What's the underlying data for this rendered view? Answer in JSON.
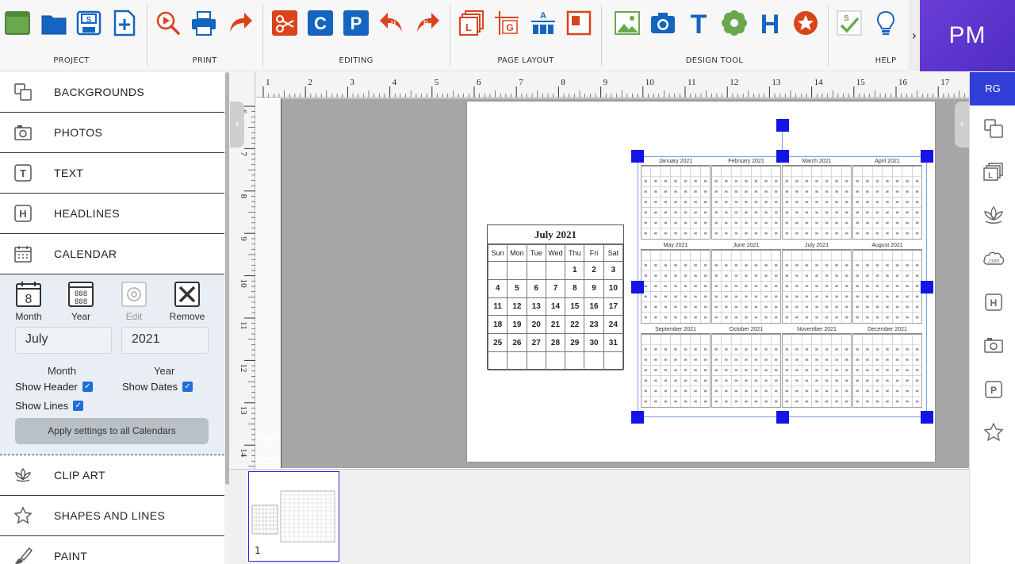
{
  "toolbar": {
    "groups": [
      {
        "label": "PROJECT"
      },
      {
        "label": "PRINT"
      },
      {
        "label": "EDITING"
      },
      {
        "label": "PAGE LAYOUT"
      },
      {
        "label": "DESIGN TOOL"
      },
      {
        "label": "HELP"
      }
    ],
    "more_glyph": "›",
    "brand_text": "PM"
  },
  "left_panel": {
    "items_top": [
      {
        "label": "BACKGROUNDS",
        "icon": "backgrounds-icon"
      },
      {
        "label": "PHOTOS",
        "icon": "camera-icon"
      },
      {
        "label": "TEXT",
        "icon": "text-icon"
      },
      {
        "label": "HEADLINES",
        "icon": "headline-icon"
      },
      {
        "label": "CALENDAR",
        "icon": "calendar-icon"
      }
    ],
    "calendar": {
      "tools": [
        {
          "label": "Month",
          "glyph": "8"
        },
        {
          "label": "Year",
          "glyph": "888"
        },
        {
          "label": "Edit",
          "disabled": true
        },
        {
          "label": "Remove"
        }
      ],
      "month_value": "July",
      "year_value": "2021",
      "month_label": "Month",
      "year_label": "Year",
      "show_header": "Show Header",
      "show_dates": "Show Dates",
      "show_lines": "Show Lines",
      "apply_button": "Apply settings to all Calendars"
    },
    "items_bottom": [
      {
        "label": "CLIP ART",
        "icon": "lotus-icon"
      },
      {
        "label": "SHAPES AND LINES",
        "icon": "star-icon"
      },
      {
        "label": "PAINT",
        "icon": "brush-icon"
      }
    ]
  },
  "canvas": {
    "ruler_top": [
      "1",
      "2",
      "3",
      "4",
      "5",
      "6",
      "7",
      "8",
      "9",
      "10",
      "11",
      "12",
      "13",
      "14",
      "15",
      "16",
      "17"
    ],
    "ruler_left": [
      "6",
      "7",
      "8",
      "9",
      "10",
      "11",
      "12",
      "13",
      "14"
    ],
    "zoom_in": "+",
    "zoom_out": "−",
    "month_calendar": {
      "title": "July 2021",
      "weekdays": [
        "Sun",
        "Mon",
        "Tue",
        "Wed",
        "Thu",
        "Fri",
        "Sat"
      ],
      "weeks": [
        [
          "",
          "",
          "",
          "",
          "1",
          "2",
          "3"
        ],
        [
          "4",
          "5",
          "6",
          "7",
          "8",
          "9",
          "10"
        ],
        [
          "11",
          "12",
          "13",
          "14",
          "15",
          "16",
          "17"
        ],
        [
          "18",
          "19",
          "20",
          "21",
          "22",
          "23",
          "24"
        ],
        [
          "25",
          "26",
          "27",
          "28",
          "29",
          "30",
          "31"
        ],
        [
          "",
          "",
          "",
          "",
          "",
          "",
          ""
        ]
      ]
    },
    "year_calendar": {
      "months": [
        "January 2021",
        "February 2021",
        "March 2021",
        "April 2021",
        "May 2021",
        "June 2021",
        "July 2021",
        "August 2021",
        "September 2021",
        "October 2021",
        "November 2021",
        "December 2021"
      ]
    }
  },
  "thumbnails": [
    {
      "number": "1"
    }
  ],
  "right_bar": {
    "tab_label": "RG",
    "icons": [
      "backgrounds-icon",
      "layouts-icon",
      "lotus-icon",
      "domain-icon",
      "headline-icon",
      "camera-icon",
      "p-icon",
      "star-icon"
    ],
    "domain_text": ".com",
    "headline_glyph": "H",
    "p_glyph": "P"
  }
}
